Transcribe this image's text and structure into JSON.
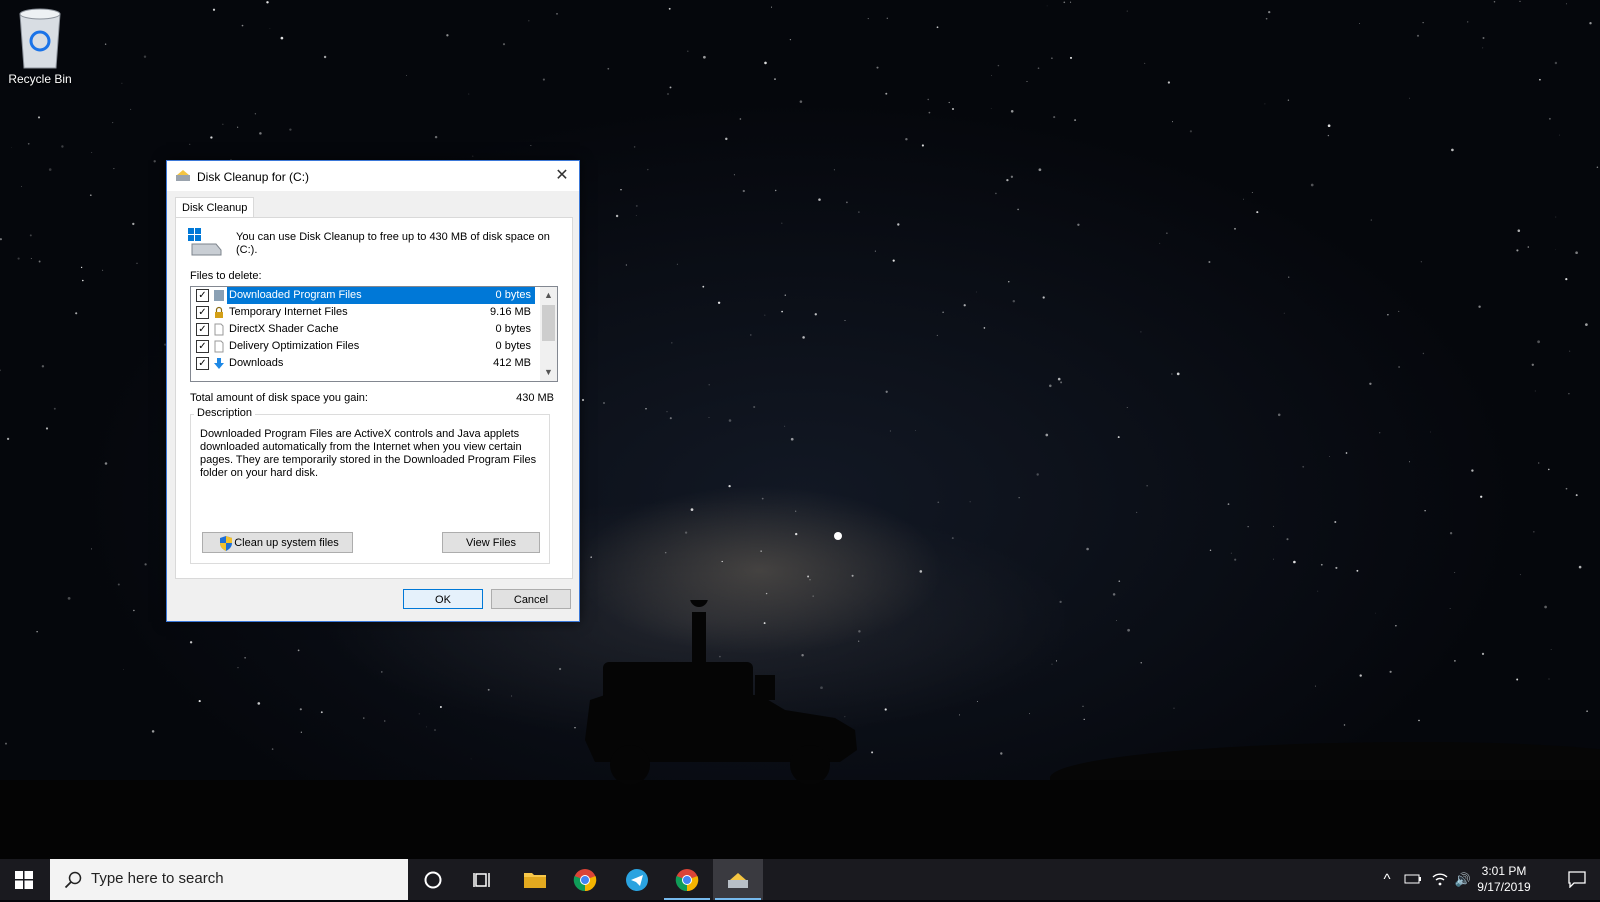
{
  "desktop": {
    "recycle_bin_label": "Recycle Bin"
  },
  "dialog": {
    "title": "Disk Cleanup for  (C:)",
    "tab_label": "Disk Cleanup",
    "info_text": "You can use Disk Cleanup to free up to 430 MB of disk space on (C:).",
    "files_label": "Files to delete:",
    "files": [
      {
        "name": "Downloaded Program Files",
        "size": "0 bytes",
        "checked": true,
        "selected": true,
        "icon": "folder-icon"
      },
      {
        "name": "Temporary Internet Files",
        "size": "9.16 MB",
        "checked": true,
        "selected": false,
        "icon": "lock-icon"
      },
      {
        "name": "DirectX Shader Cache",
        "size": "0 bytes",
        "checked": true,
        "selected": false,
        "icon": "file-icon"
      },
      {
        "name": "Delivery Optimization Files",
        "size": "0 bytes",
        "checked": true,
        "selected": false,
        "icon": "file-icon"
      },
      {
        "name": "Downloads",
        "size": "412 MB",
        "checked": true,
        "selected": false,
        "icon": "download-arrow-icon"
      }
    ],
    "total_label": "Total amount of disk space you gain:",
    "total_value": "430 MB",
    "description_label": "Description",
    "description_text": "Downloaded Program Files are ActiveX controls and Java applets downloaded automatically from the Internet when you view certain pages. They are temporarily stored in the Downloaded Program Files folder on your hard disk.",
    "cleanup_button": "Clean up system files",
    "view_files_button": "View Files",
    "ok_button": "OK",
    "cancel_button": "Cancel",
    "checkmark": "✓",
    "close_glyph": "✕",
    "scroll_up_glyph": "▲",
    "scroll_down_glyph": "▼"
  },
  "taskbar": {
    "search_placeholder": "Type here to search",
    "time": "3:01 PM",
    "date": "9/17/2019",
    "tray_chevron": "^",
    "tray_volume": "🔊"
  },
  "colors": {
    "accent": "#0078d7",
    "taskbar": "#1a1a1f",
    "dialog_bg": "#f0f0f0"
  }
}
